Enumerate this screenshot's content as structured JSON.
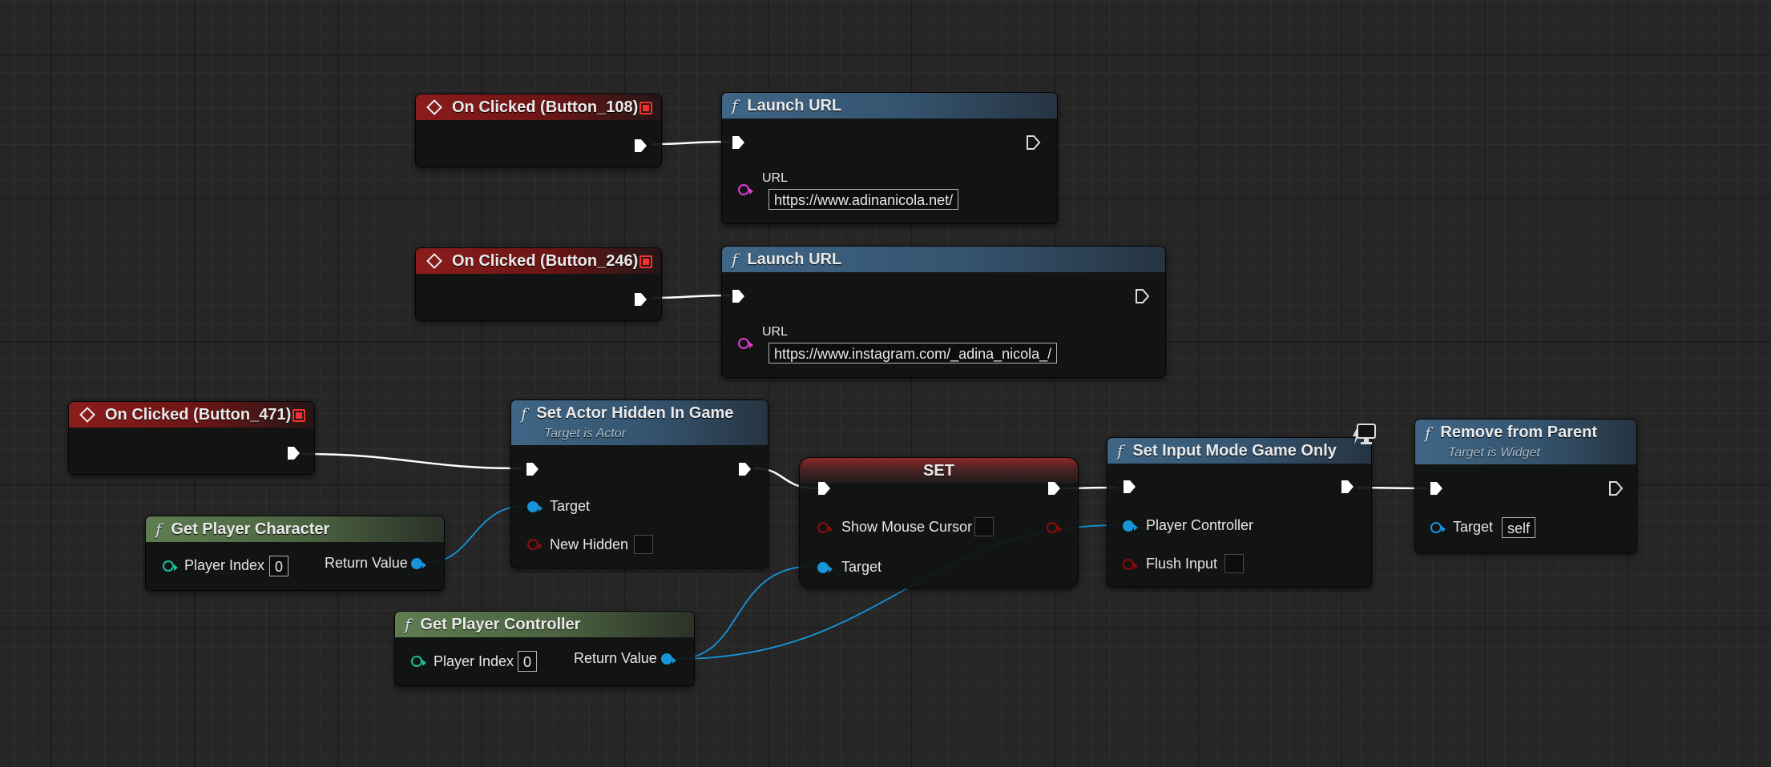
{
  "graph": {
    "event_nodes": [
      {
        "title": "On Clicked (Button_108)"
      },
      {
        "title": "On Clicked (Button_246)"
      },
      {
        "title": "On Clicked (Button_471)"
      }
    ],
    "launch_url_1": {
      "title": "Launch URL",
      "url_label": "URL",
      "url_value": "https://www.adinanicola.net/"
    },
    "launch_url_2": {
      "title": "Launch URL",
      "url_label": "URL",
      "url_value": "https://www.instagram.com/_adina_nicola_/"
    },
    "set_actor_hidden": {
      "title": "Set Actor Hidden In Game",
      "subtitle": "Target is Actor",
      "target_label": "Target",
      "new_hidden_label": "New Hidden"
    },
    "get_player_character": {
      "title": "Get Player Character",
      "player_index_label": "Player Index",
      "player_index_value": "0",
      "return_label": "Return Value"
    },
    "get_player_controller": {
      "title": "Get Player Controller",
      "player_index_label": "Player Index",
      "player_index_value": "0",
      "return_label": "Return Value"
    },
    "set_node": {
      "title": "SET",
      "show_mouse_label": "Show Mouse Cursor",
      "target_label": "Target"
    },
    "set_input_mode": {
      "title": "Set Input Mode Game Only",
      "player_controller_label": "Player Controller",
      "flush_input_label": "Flush Input"
    },
    "remove_from_parent": {
      "title": "Remove from Parent",
      "subtitle": "Target is Widget",
      "target_label": "Target",
      "target_value": "self"
    },
    "function_glyph": "f"
  },
  "colors": {
    "exec_wire": "#ffffff",
    "object_pin": "#1795d9",
    "integer_pin": "#1fbf98",
    "string_pin": "#e03ad8",
    "bool_pin": "#8d0d0d",
    "event_header": "#8c1c1c",
    "function_header": "#3f6686",
    "pure_header": "#5f7d51"
  },
  "icons": [
    "event-diamond-icon",
    "delegate-square-icon",
    "function-icon",
    "exec-arrow-icon",
    "network-monitor-icon"
  ]
}
